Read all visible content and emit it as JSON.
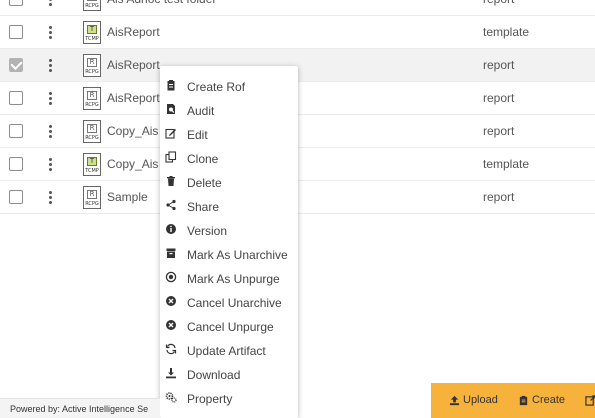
{
  "rows": [
    {
      "name": "Ais Adhoc test folder",
      "type": "report",
      "icon": "report-file-icon",
      "checked": false
    },
    {
      "name": "AisReport",
      "type": "template",
      "icon": "template-file-icon",
      "checked": false
    },
    {
      "name": "AisReport",
      "type": "report",
      "icon": "report-file-icon",
      "checked": true
    },
    {
      "name": "AisReport",
      "type": "report",
      "icon": "report-file-icon",
      "checked": false
    },
    {
      "name": "Copy_Ais",
      "type": "report",
      "icon": "report-file-icon",
      "checked": false
    },
    {
      "name": "Copy_Ais",
      "type": "template",
      "icon": "template-file-icon",
      "checked": false
    },
    {
      "name": "Sample",
      "type": "report",
      "icon": "report-file-icon",
      "checked": false
    }
  ],
  "file_icon_text": {
    "report_badge": "R",
    "template_badge": "T",
    "report_tag": "RCPG",
    "template_tag": "TCMP"
  },
  "context_menu": [
    {
      "label": "Create Rof",
      "icon": "clipboard-icon"
    },
    {
      "label": "Audit",
      "icon": "audit-search-icon"
    },
    {
      "label": "Edit",
      "icon": "edit-icon"
    },
    {
      "label": "Clone",
      "icon": "clone-icon"
    },
    {
      "label": "Delete",
      "icon": "trash-icon"
    },
    {
      "label": "Share",
      "icon": "share-icon"
    },
    {
      "label": "Version",
      "icon": "info-icon"
    },
    {
      "label": "Mark As Unarchive",
      "icon": "archive-icon"
    },
    {
      "label": "Mark As Unpurge",
      "icon": "circle-x-outline-icon"
    },
    {
      "label": "Cancel Unarchive",
      "icon": "circle-x-icon"
    },
    {
      "label": "Cancel Unpurge",
      "icon": "circle-x-icon"
    },
    {
      "label": "Update Artifact",
      "icon": "refresh-icon"
    },
    {
      "label": "Download",
      "icon": "download-icon"
    },
    {
      "label": "Property",
      "icon": "cogs-icon"
    }
  ],
  "footer": {
    "text": "Powered by: Active Intelligence Se"
  },
  "actions": {
    "upload": "Upload",
    "create": "Create"
  },
  "colors": {
    "accent": "#f7b23b",
    "selected_row": "#f2f2f2"
  }
}
